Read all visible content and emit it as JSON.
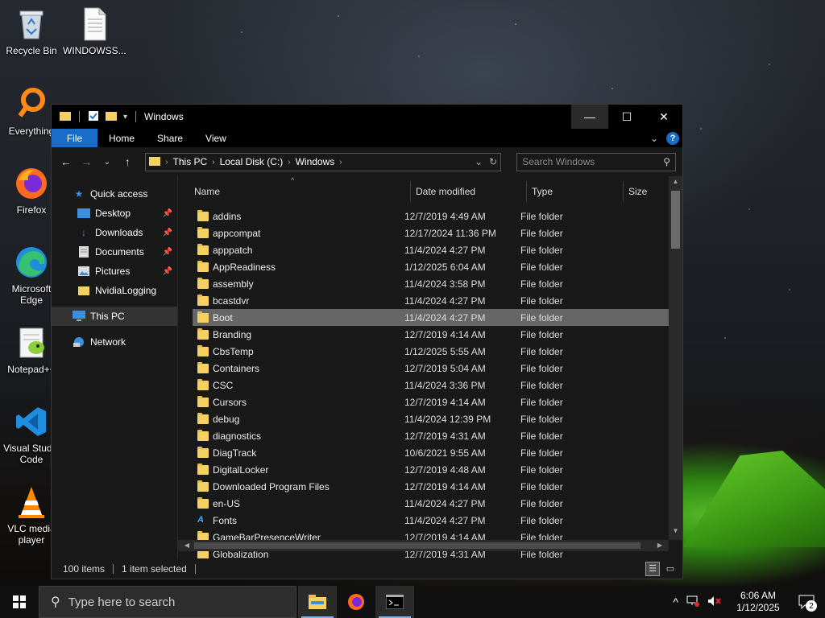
{
  "desktop": {
    "icons": [
      {
        "label": "Recycle Bin"
      },
      {
        "label": "WINDOWSS..."
      },
      {
        "label": "Everything"
      },
      {
        "label": "Firefox"
      },
      {
        "label": "Microsoft Edge"
      },
      {
        "label": "Notepad++"
      },
      {
        "label": "Visual Studio Code"
      },
      {
        "label": "VLC media player"
      }
    ]
  },
  "window": {
    "title": "Windows",
    "ribbon_tabs": [
      "File",
      "Home",
      "Share",
      "View"
    ],
    "help_label": "?",
    "breadcrumb": [
      "This PC",
      "Local Disk (C:)",
      "Windows"
    ],
    "search_placeholder": "Search Windows",
    "columns": [
      "Name",
      "Date modified",
      "Type",
      "Size"
    ],
    "nav": {
      "quick_access": "Quick access",
      "items": [
        "Desktop",
        "Downloads",
        "Documents",
        "Pictures",
        "NvidiaLogging"
      ],
      "this_pc": "This PC",
      "network": "Network"
    },
    "files": [
      {
        "name": "addins",
        "date": "12/7/2019 4:49 AM",
        "type": "File folder"
      },
      {
        "name": "appcompat",
        "date": "12/17/2024 11:36 PM",
        "type": "File folder"
      },
      {
        "name": "apppatch",
        "date": "11/4/2024 4:27 PM",
        "type": "File folder"
      },
      {
        "name": "AppReadiness",
        "date": "1/12/2025 6:04 AM",
        "type": "File folder"
      },
      {
        "name": "assembly",
        "date": "11/4/2024 3:58 PM",
        "type": "File folder"
      },
      {
        "name": "bcastdvr",
        "date": "11/4/2024 4:27 PM",
        "type": "File folder"
      },
      {
        "name": "Boot",
        "date": "11/4/2024 4:27 PM",
        "type": "File folder"
      },
      {
        "name": "Branding",
        "date": "12/7/2019 4:14 AM",
        "type": "File folder"
      },
      {
        "name": "CbsTemp",
        "date": "1/12/2025 5:55 AM",
        "type": "File folder"
      },
      {
        "name": "Containers",
        "date": "12/7/2019 5:04 AM",
        "type": "File folder"
      },
      {
        "name": "CSC",
        "date": "11/4/2024 3:36 PM",
        "type": "File folder"
      },
      {
        "name": "Cursors",
        "date": "12/7/2019 4:14 AM",
        "type": "File folder"
      },
      {
        "name": "debug",
        "date": "11/4/2024 12:39 PM",
        "type": "File folder"
      },
      {
        "name": "diagnostics",
        "date": "12/7/2019 4:31 AM",
        "type": "File folder"
      },
      {
        "name": "DiagTrack",
        "date": "10/6/2021 9:55 AM",
        "type": "File folder"
      },
      {
        "name": "DigitalLocker",
        "date": "12/7/2019 4:48 AM",
        "type": "File folder"
      },
      {
        "name": "Downloaded Program Files",
        "date": "12/7/2019 4:14 AM",
        "type": "File folder"
      },
      {
        "name": "en-US",
        "date": "11/4/2024 4:27 PM",
        "type": "File folder"
      },
      {
        "name": "Fonts",
        "date": "11/4/2024 4:27 PM",
        "type": "File folder"
      },
      {
        "name": "GameBarPresenceWriter",
        "date": "12/7/2019 4:14 AM",
        "type": "File folder"
      },
      {
        "name": "Globalization",
        "date": "12/7/2019 4:31 AM",
        "type": "File folder"
      }
    ],
    "selected_file": "Boot",
    "status": {
      "count": "100 items",
      "selection": "1 item selected"
    }
  },
  "taskbar": {
    "search_placeholder": "Type here to search",
    "time": "6:06 AM",
    "date": "1/12/2025",
    "notification_count": "2"
  },
  "colors": {
    "accent": "#1a6dc6",
    "folder": "#f5d164",
    "window_bg": "#191919",
    "selection": "#666666"
  }
}
